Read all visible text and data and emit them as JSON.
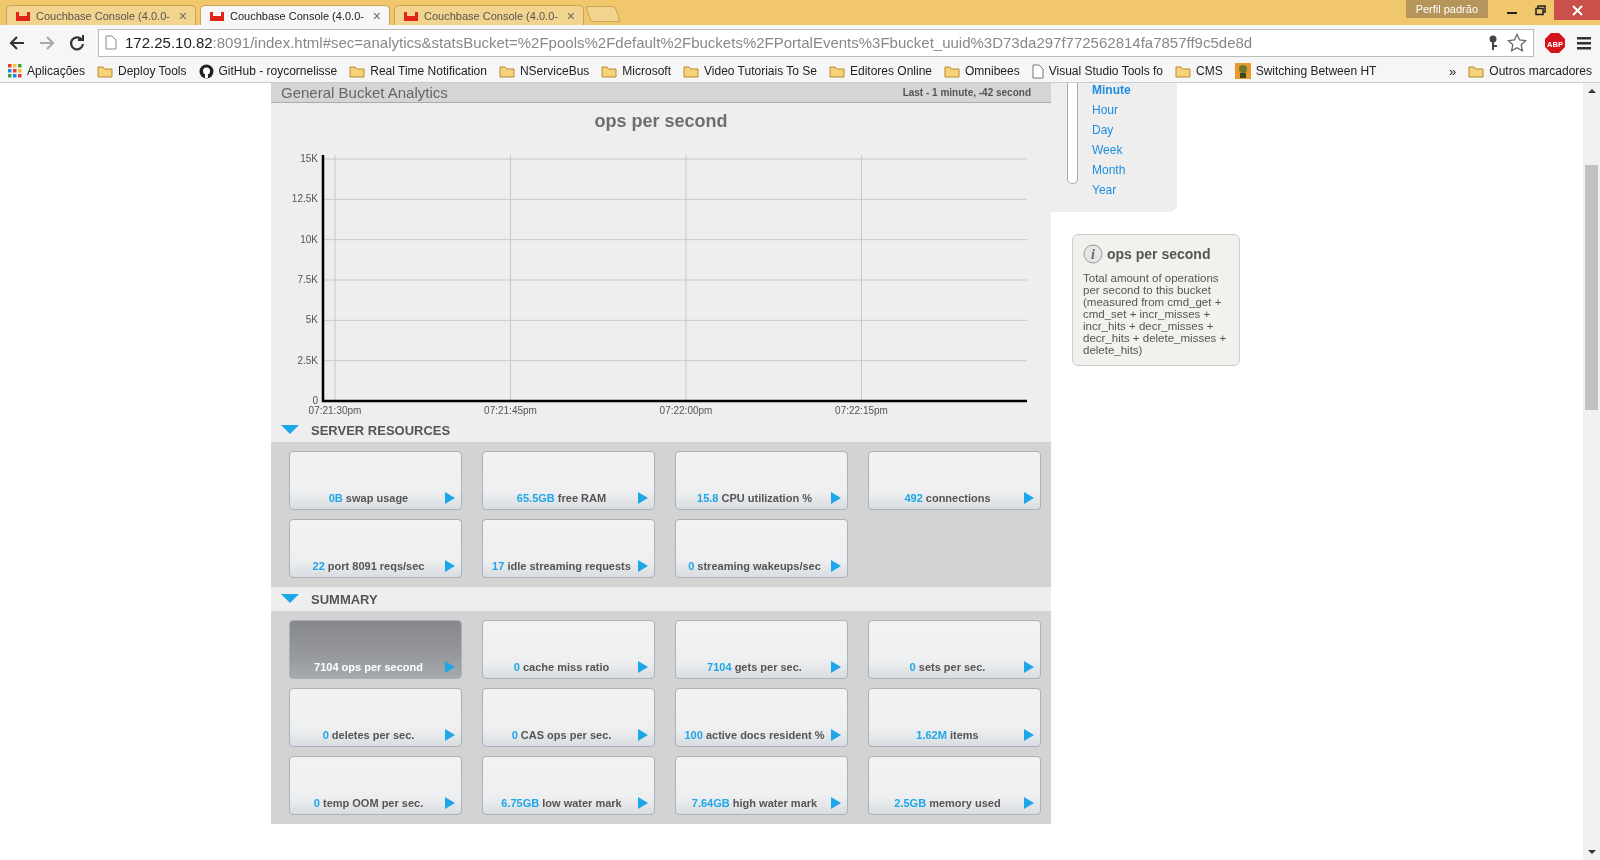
{
  "browser": {
    "tabs": [
      {
        "title": "Couchbase Console (4.0.0-",
        "selected": false
      },
      {
        "title": "Couchbase Console (4.0.0-",
        "selected": true
      },
      {
        "title": "Couchbase Console (4.0.0-",
        "selected": false
      }
    ],
    "tab_close": "×",
    "adblock": "ABP",
    "profile": "Perfil padrão",
    "url": {
      "host": "172.25.10.82",
      "rest": ":8091/index.html#sec=analytics&statsBucket=%2Fpools%2Fdefault%2Fbuckets%2FPortalEvents%3Fbucket_uuid%3D73da297f772562814fa7857ff9c5de8d"
    },
    "bookmarks": [
      {
        "kind": "apps",
        "label": "Aplicações"
      },
      {
        "kind": "folder",
        "label": "Deploy Tools"
      },
      {
        "kind": "github",
        "label": "GitHub - roycornelisse"
      },
      {
        "kind": "folder",
        "label": "Real Time Notification"
      },
      {
        "kind": "folder",
        "label": "NServiceBus"
      },
      {
        "kind": "folder",
        "label": "Microsoft"
      },
      {
        "kind": "folder",
        "label": "Video Tutoriais To Se"
      },
      {
        "kind": "folder",
        "label": "Editores Online"
      },
      {
        "kind": "folder",
        "label": "Omnibees"
      },
      {
        "kind": "page",
        "label": "Visual Studio Tools fo"
      },
      {
        "kind": "folder",
        "label": "CMS"
      },
      {
        "kind": "image",
        "label": "Switching Between HT"
      }
    ],
    "more": "»",
    "other_bookmarks": "Outros marcadores"
  },
  "analytics": {
    "title": "General Bucket Analytics",
    "range_text": "Last - 1 minute, -42 second",
    "chart_data": {
      "type": "line",
      "title": "ops per second",
      "categories": [
        "07:21:30pm",
        "07:21:45pm",
        "07:22:00pm",
        "07:22:15pm",
        null
      ],
      "ylim": [
        0,
        15000
      ],
      "yticks": [
        {
          "value": 0,
          "label": "0"
        },
        {
          "value": 2500,
          "label": "2.5K"
        },
        {
          "value": 5000,
          "label": "5K"
        },
        {
          "value": 7500,
          "label": "7.5K"
        },
        {
          "value": 10000,
          "label": "10K"
        },
        {
          "value": 12500,
          "label": "12.5K"
        },
        {
          "value": 15000,
          "label": "15K"
        }
      ],
      "grid": true
    }
  },
  "zoom": [
    {
      "label": "Minute",
      "selected": true
    },
    {
      "label": "Hour",
      "selected": false
    },
    {
      "label": "Day",
      "selected": false
    },
    {
      "label": "Week",
      "selected": false
    },
    {
      "label": "Month",
      "selected": false
    },
    {
      "label": "Year",
      "selected": false
    }
  ],
  "info": {
    "icon": "i",
    "title": "ops per second",
    "text": "Total amount of operations per second to this bucket (measured from cmd_get + cmd_set + incr_misses + incr_hits + decr_misses + decr_hits + delete_misses + delete_hits)"
  },
  "sections": [
    {
      "title": "SERVER RESOURCES",
      "expanded": true,
      "tiles": [
        {
          "value": "0B",
          "label": "swap usage",
          "selected": false
        },
        {
          "value": "65.5GB",
          "label": "free RAM",
          "selected": false
        },
        {
          "value": "15.8",
          "label": "CPU utilization %",
          "selected": false
        },
        {
          "value": "492",
          "label": "connections",
          "selected": false
        },
        {
          "value": "22",
          "label": "port 8091 reqs/sec",
          "selected": false
        },
        {
          "value": "17",
          "label": "idle streaming requests",
          "selected": false
        },
        {
          "value": "0",
          "label": "streaming wakeups/sec",
          "selected": false
        }
      ]
    },
    {
      "title": "SUMMARY",
      "expanded": true,
      "tiles": [
        {
          "value": "7104",
          "label": "ops per second",
          "selected": true
        },
        {
          "value": "0",
          "label": "cache miss ratio",
          "selected": false
        },
        {
          "value": "7104",
          "label": "gets per sec.",
          "selected": false
        },
        {
          "value": "0",
          "label": "sets per sec.",
          "selected": false
        },
        {
          "value": "0",
          "label": "deletes per sec.",
          "selected": false
        },
        {
          "value": "0",
          "label": "CAS ops per sec.",
          "selected": false
        },
        {
          "value": "100",
          "label": "active docs resident %",
          "selected": false
        },
        {
          "value": "1.62M",
          "label": "items",
          "selected": false
        },
        {
          "value": "0",
          "label": "temp OOM per sec.",
          "selected": false
        },
        {
          "value": "6.75GB",
          "label": "low water mark",
          "selected": false
        },
        {
          "value": "7.64GB",
          "label": "high water mark",
          "selected": false
        },
        {
          "value": "2.5GB",
          "label": "memory used",
          "selected": false
        }
      ]
    }
  ]
}
